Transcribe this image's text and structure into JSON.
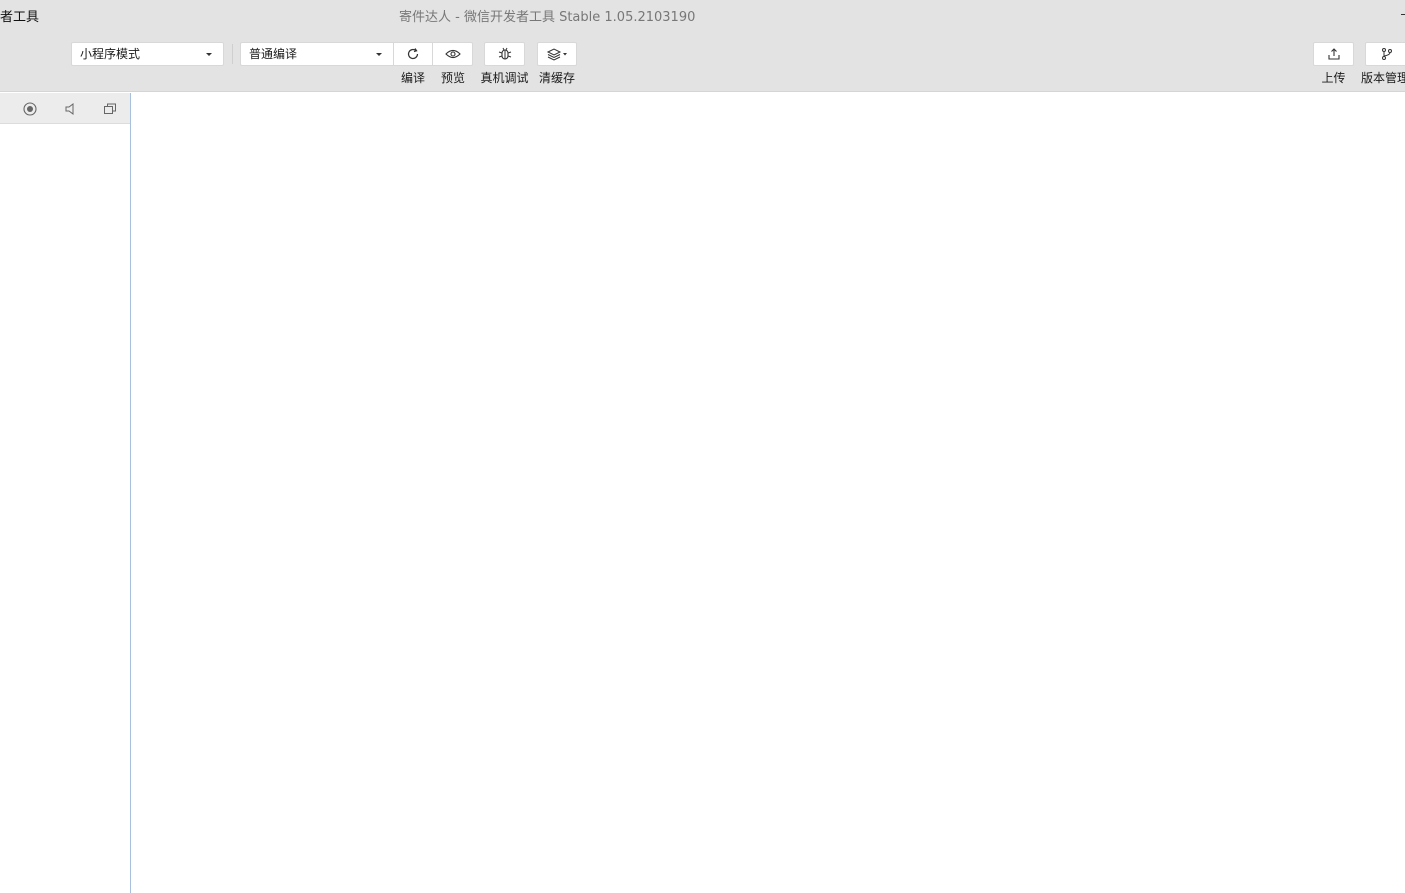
{
  "titlebar": {
    "app_menu_name": "发者工具",
    "window_title": "寄件达人 - 微信开发者工具 Stable 1.05.2103190"
  },
  "toolbar": {
    "mode_select": {
      "value": "小程序模式"
    },
    "compile_select": {
      "value": "普通编译"
    },
    "buttons": {
      "compile": {
        "label": "编译",
        "icon": "refresh-icon"
      },
      "preview": {
        "label": "预览",
        "icon": "eye-icon"
      },
      "remote_debug": {
        "label": "真机调试",
        "icon": "bug-icon"
      },
      "clear_cache": {
        "label": "清缓存",
        "icon": "layers-icon"
      },
      "upload": {
        "label": "上传",
        "icon": "upload-icon"
      },
      "version": {
        "label": "版本管理",
        "icon": "branch-icon"
      }
    }
  },
  "simulator_toolbar": {
    "icons": [
      "stop-icon",
      "volume-icon",
      "window-icon"
    ]
  },
  "colors": {
    "chrome": "#e3e3e3",
    "panel_border": "#a9bfde",
    "title_text": "#777777"
  }
}
